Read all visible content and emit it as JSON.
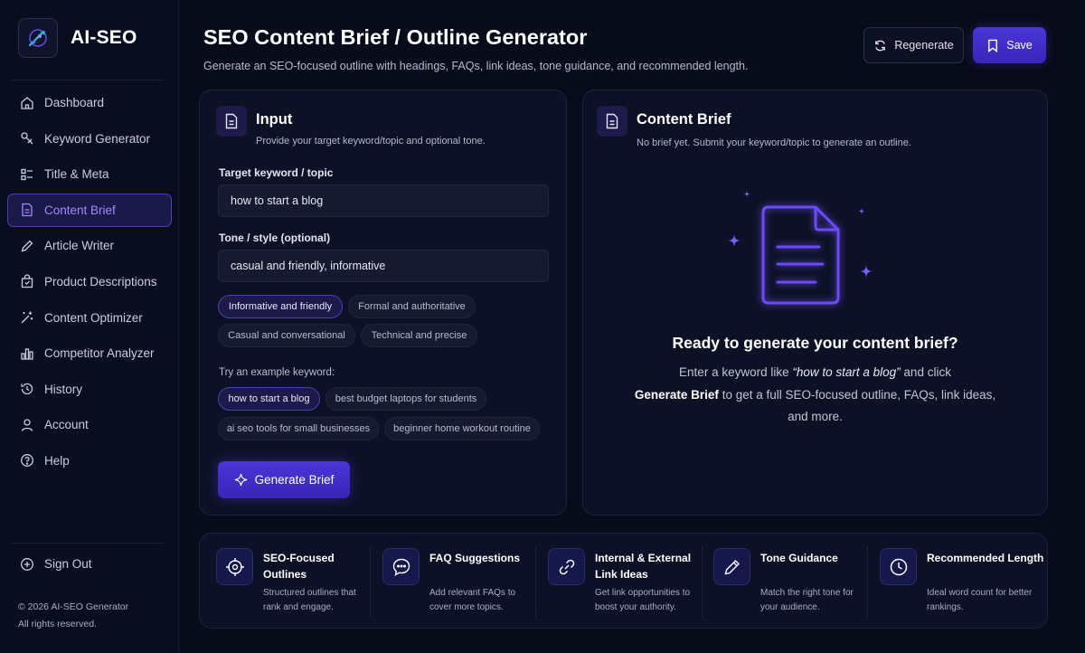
{
  "app": {
    "name": "AI-SEO"
  },
  "sidebar": {
    "items": [
      {
        "label": "Dashboard",
        "icon": "home-icon"
      },
      {
        "label": "Keyword Generator",
        "icon": "keyword-icon"
      },
      {
        "label": "Title & Meta",
        "icon": "title-meta-icon"
      },
      {
        "label": "Content Brief",
        "icon": "document-icon",
        "active": true
      },
      {
        "label": "Article Writer",
        "icon": "pencil-icon"
      },
      {
        "label": "Product Descriptions",
        "icon": "shopping-bag-icon"
      },
      {
        "label": "Content Optimizer",
        "icon": "optimizer-icon"
      },
      {
        "label": "Competitor Analyzer",
        "icon": "bar-chart-icon"
      },
      {
        "label": "History",
        "icon": "history-icon"
      },
      {
        "label": "Account",
        "icon": "user-icon"
      },
      {
        "label": "Help",
        "icon": "help-icon"
      }
    ],
    "sign_out": "Sign Out",
    "copyright_line1": "© 2026 AI-SEO Generator",
    "copyright_line2": "All rights reserved."
  },
  "header": {
    "title": "SEO Content Brief / Outline Generator",
    "subtitle": "Generate an SEO-focused outline with headings, FAQs, link ideas, tone guidance, and recommended length.",
    "regenerate_label": "Regenerate",
    "save_label": "Save"
  },
  "input_card": {
    "title": "Input",
    "subtitle": "Provide your target keyword/topic and optional tone.",
    "keyword_label": "Target keyword / topic",
    "keyword_value": "how to start a blog",
    "tone_label": "Tone / style (optional)",
    "tone_value": "casual and friendly, informative",
    "tone_chips": [
      {
        "label": "Informative and friendly",
        "selected": true
      },
      {
        "label": "Formal and authoritative",
        "selected": false
      },
      {
        "label": "Casual and conversational",
        "selected": false
      },
      {
        "label": "Technical and precise",
        "selected": false
      }
    ],
    "examples_label": "Try an example keyword:",
    "example_chips": [
      {
        "label": "how to start a blog",
        "selected": true
      },
      {
        "label": "best budget laptops for students",
        "selected": false
      },
      {
        "label": "ai seo tools for small businesses",
        "selected": false
      },
      {
        "label": "beginner home workout routine",
        "selected": false
      }
    ],
    "generate_label": "Generate Brief"
  },
  "brief_card": {
    "title": "Content Brief",
    "subtitle": "No brief yet. Submit your keyword/topic to generate an outline.",
    "empty_title": "Ready to generate your content brief?",
    "empty_text_1": "Enter a keyword like ",
    "empty_text_example": "“how to start a blog”",
    "empty_text_2": " and click ",
    "empty_text_button": "Generate Brief",
    "empty_text_3": " to get a full SEO-focused outline, FAQs, link ideas, and more."
  },
  "features": [
    {
      "title": "SEO-Focused Outlines",
      "desc": "Structured outlines that rank and engage.",
      "icon": "target-icon"
    },
    {
      "title": "FAQ Suggestions",
      "desc": "Add relevant FAQs to cover more topics.",
      "icon": "chat-bubble-icon"
    },
    {
      "title": "Internal & External Link Ideas",
      "desc": "Get link opportunities to boost your authority.",
      "icon": "link-icon"
    },
    {
      "title": "Tone Guidance",
      "desc": "Match the right tone for your audience.",
      "icon": "pen-icon"
    },
    {
      "title": "Recommended Length",
      "desc": "Ideal word count for better rankings.",
      "icon": "clock-icon"
    }
  ],
  "colors": {
    "accent": "#4a36d8",
    "accent_text": "#9e8cff",
    "background": "#080b19",
    "card": "#0d1126"
  }
}
